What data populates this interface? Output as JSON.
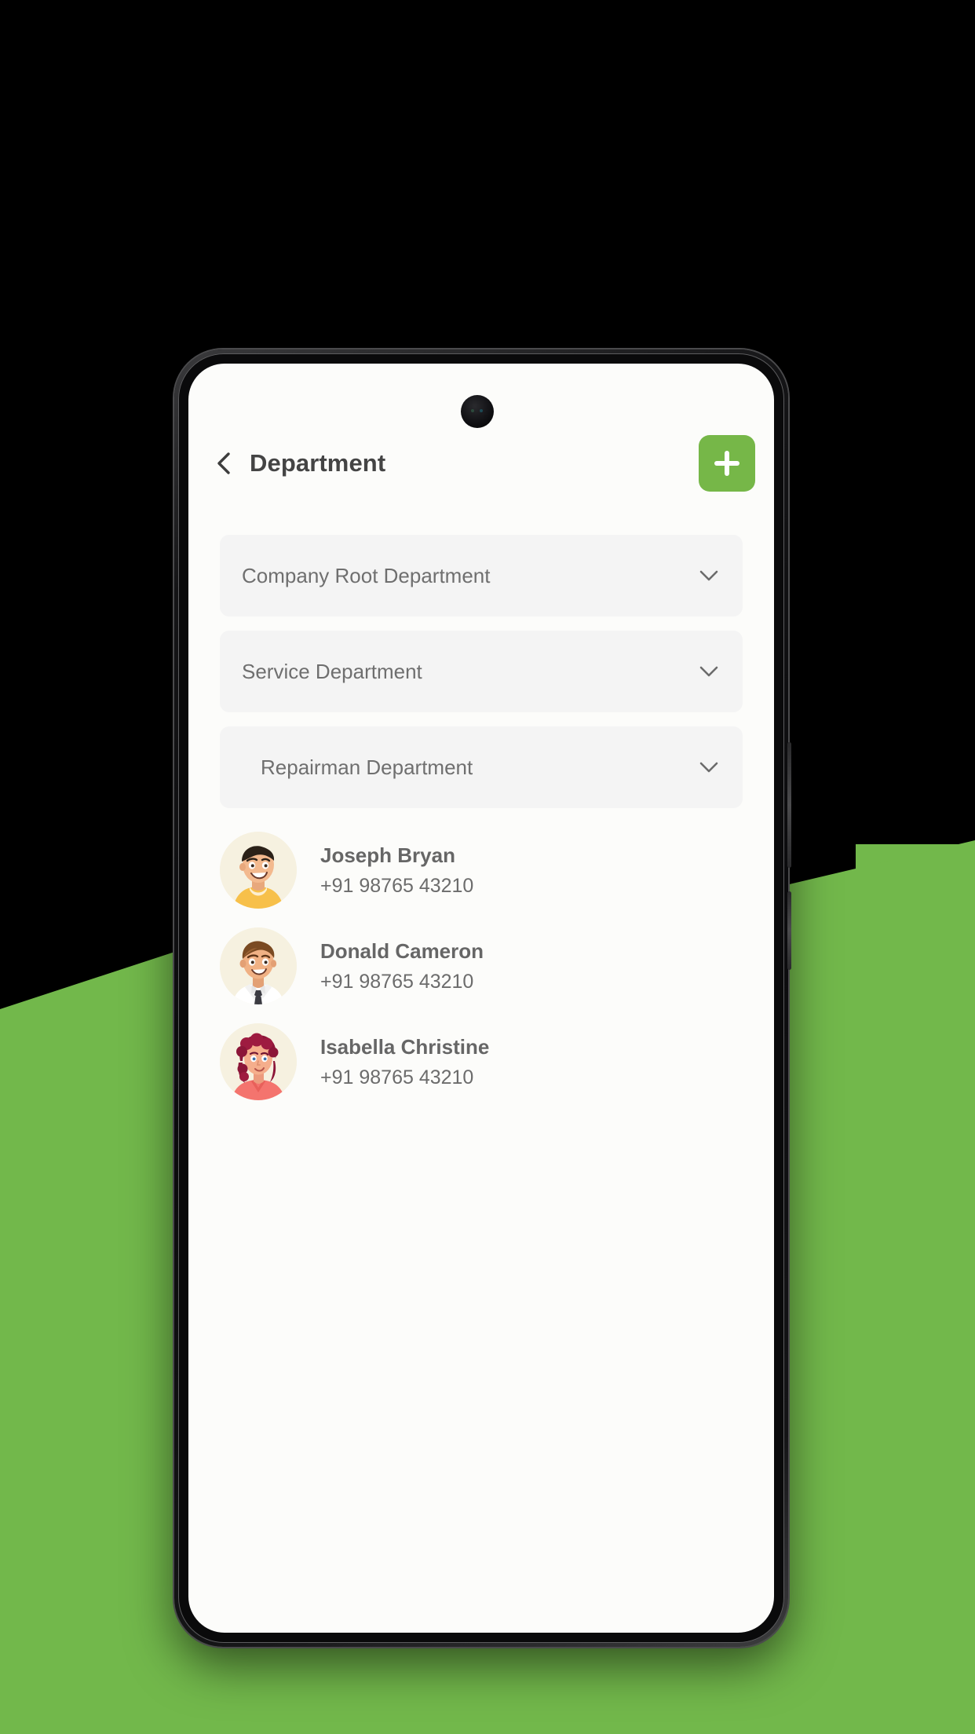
{
  "theme": {
    "background_green": "#72B84B",
    "accent_green": "#76B748",
    "screen_background": "#FCFCFA",
    "row_background": "#F4F4F4",
    "title_color": "#444444",
    "muted_text": "#6F6F6F"
  },
  "header": {
    "back_icon": "chevron-left-icon",
    "title": "Department",
    "add_icon": "plus-icon",
    "add_label": "+"
  },
  "departments": [
    {
      "label": "Company Root Department",
      "level": 1,
      "chevron": "chevron-down-icon",
      "expanded": false
    },
    {
      "label": "Service Department",
      "level": 1,
      "chevron": "chevron-down-icon",
      "expanded": false
    },
    {
      "label": "Repairman Department",
      "level": 2,
      "chevron": "chevron-down-icon",
      "expanded": true
    }
  ],
  "contacts": [
    {
      "name": "Joseph Bryan",
      "phone": "+91 98765 43210",
      "avatar": "avatar-man-yellow-shirt"
    },
    {
      "name": "Donald Cameron",
      "phone": "+91 98765 43210",
      "avatar": "avatar-man-white-shirt-tie"
    },
    {
      "name": "Isabella Christine",
      "phone": "+91 98765 43210",
      "avatar": "avatar-woman-red-hair"
    }
  ]
}
